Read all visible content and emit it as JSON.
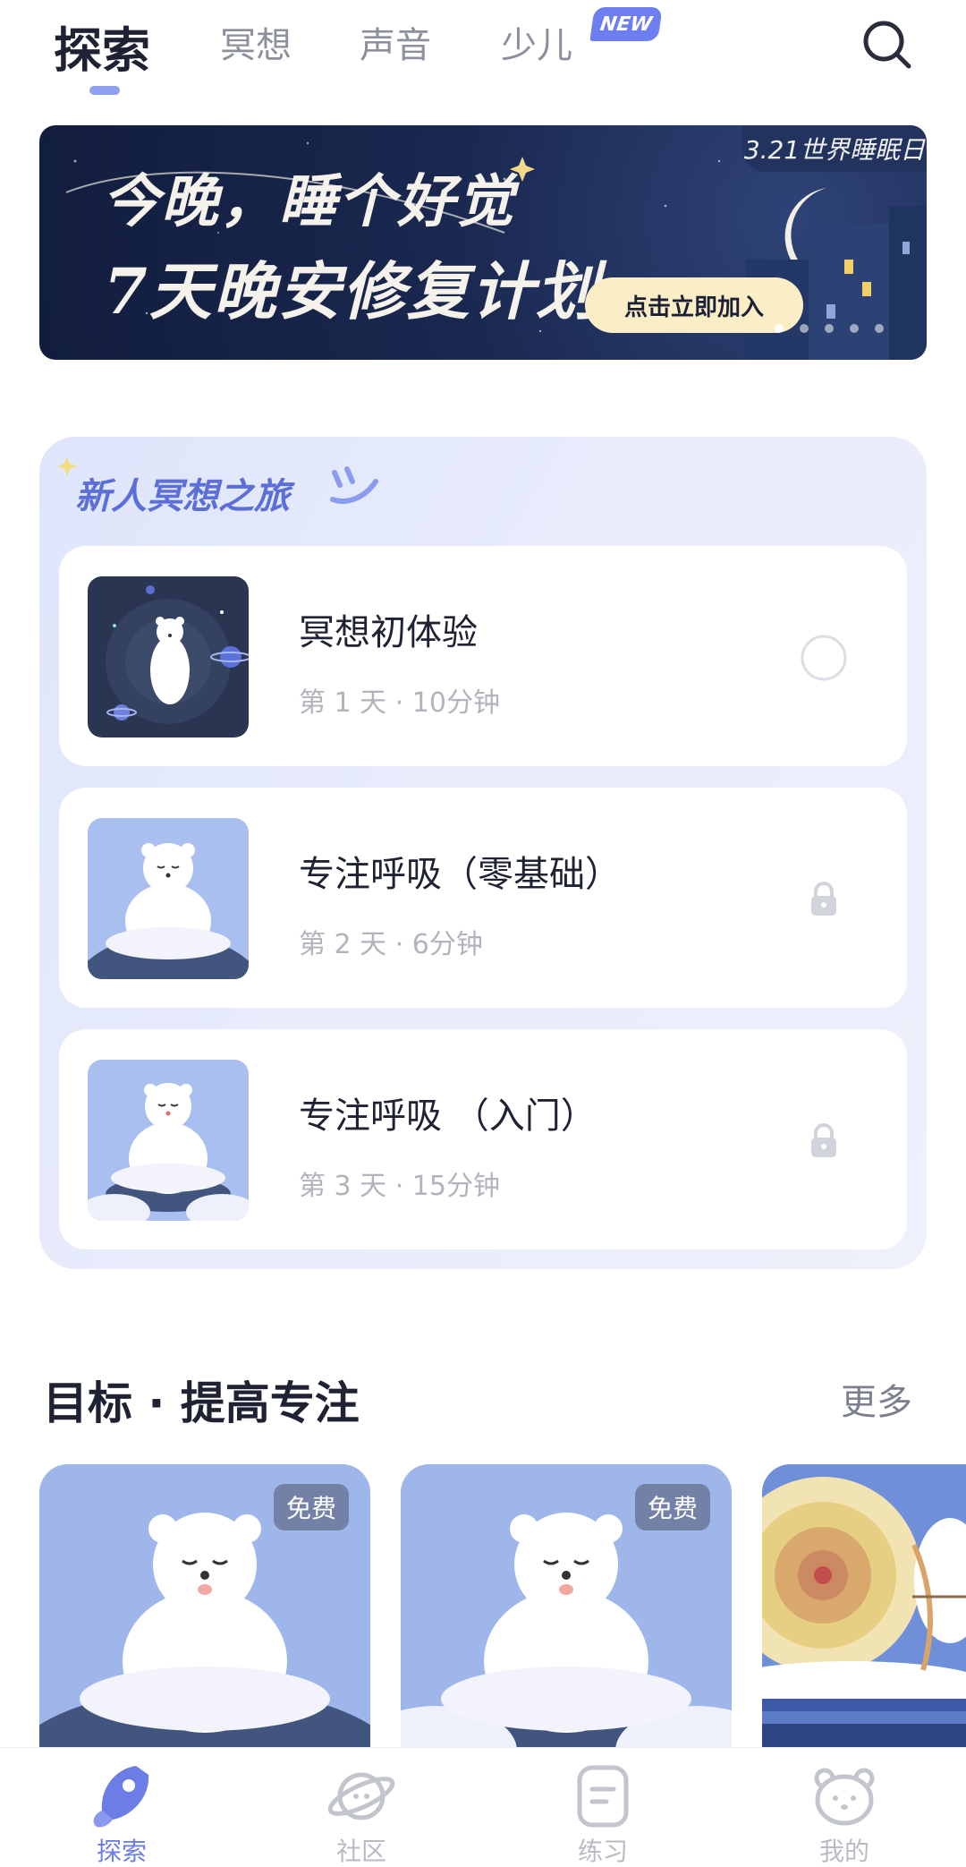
{
  "top_tabs": {
    "items": [
      {
        "label": "探索",
        "active": true
      },
      {
        "label": "冥想",
        "active": false
      },
      {
        "label": "声音",
        "active": false
      },
      {
        "label": "少儿",
        "active": false
      }
    ],
    "new_badge": "NEW"
  },
  "banner": {
    "title": "今晚，睡个好觉",
    "subtitle": "7天晚安修复计划",
    "tag": "3.21世界睡眠日",
    "cta": "点击立即加入",
    "page_count": 5,
    "active_page": 0
  },
  "journey": {
    "title": "新人冥想之旅",
    "lessons": [
      {
        "name": "冥想初体验",
        "meta": "第 1 天 · 10分钟",
        "status": "open"
      },
      {
        "name": "专注呼吸（零基础）",
        "meta": "第 2 天 · 6分钟",
        "status": "locked"
      },
      {
        "name": "专注呼吸 （入门）",
        "meta": "第 3 天 · 15分钟",
        "status": "locked"
      }
    ]
  },
  "goal_section": {
    "title": "目标 · 提高专注",
    "more": "更多",
    "cards": [
      {
        "badge": "免费"
      },
      {
        "badge": "免费"
      },
      {
        "badge": ""
      }
    ]
  },
  "bottom_nav": {
    "items": [
      {
        "label": "探索",
        "icon": "rocket-icon",
        "active": true
      },
      {
        "label": "社区",
        "icon": "planet-icon",
        "active": false
      },
      {
        "label": "练习",
        "icon": "notebook-icon",
        "active": false
      },
      {
        "label": "我的",
        "icon": "bear-face-icon",
        "active": false
      }
    ]
  },
  "colors": {
    "accent": "#6c7ee6",
    "banner_bg": "#1a2850",
    "journey_bg": "#e3e8fb",
    "card_bg": "#9fb6ea"
  }
}
